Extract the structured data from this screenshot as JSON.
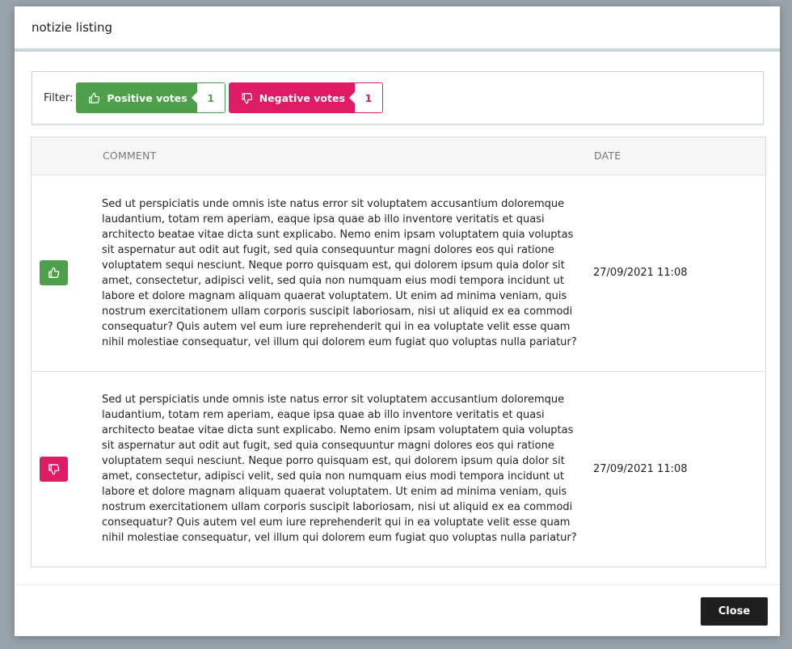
{
  "modal": {
    "title": "notizie listing"
  },
  "filter": {
    "label": "Filter:",
    "positive": {
      "label": "Positive votes",
      "count": "1",
      "icon": "thumbs-up-icon",
      "color": "#4e9f4a"
    },
    "negative": {
      "label": "Negative votes",
      "count": "1",
      "icon": "thumbs-down-icon",
      "color": "#dd1c65"
    }
  },
  "table": {
    "columns": [
      "",
      "COMMENT",
      "DATE"
    ],
    "rows": [
      {
        "vote": "positive",
        "icon": "thumbs-up-icon",
        "comment": "Sed ut perspiciatis unde omnis iste natus error sit voluptatem accusantium doloremque laudantium, totam rem aperiam, eaque ipsa quae ab illo inventore veritatis et quasi architecto beatae vitae dicta sunt explicabo. Nemo enim ipsam voluptatem quia voluptas sit aspernatur aut odit aut fugit, sed quia consequuntur magni dolores eos qui ratione voluptatem sequi nesciunt. Neque porro quisquam est, qui dolorem ipsum quia dolor sit amet, consectetur, adipisci velit, sed quia non numquam eius modi tempora incidunt ut labore et dolore magnam aliquam quaerat voluptatem. Ut enim ad minima veniam, quis nostrum exercitationem ullam corporis suscipit laboriosam, nisi ut aliquid ex ea commodi consequatur? Quis autem vel eum iure reprehenderit qui in ea voluptate velit esse quam nihil molestiae consequatur, vel illum qui dolorem eum fugiat quo voluptas nulla pariatur?",
        "date": "27/09/2021 11:08"
      },
      {
        "vote": "negative",
        "icon": "thumbs-down-icon",
        "comment": "Sed ut perspiciatis unde omnis iste natus error sit voluptatem accusantium doloremque laudantium, totam rem aperiam, eaque ipsa quae ab illo inventore veritatis et quasi architecto beatae vitae dicta sunt explicabo. Nemo enim ipsam voluptatem quia voluptas sit aspernatur aut odit aut fugit, sed quia consequuntur magni dolores eos qui ratione voluptatem sequi nesciunt. Neque porro quisquam est, qui dolorem ipsum quia dolor sit amet, consectetur, adipisci velit, sed quia non numquam eius modi tempora incidunt ut labore et dolore magnam aliquam quaerat voluptatem. Ut enim ad minima veniam, quis nostrum exercitationem ullam corporis suscipit laboriosam, nisi ut aliquid ex ea commodi consequatur? Quis autem vel eum iure reprehenderit qui in ea voluptate velit esse quam nihil molestiae consequatur, vel illum qui dolorem eum fugiat quo voluptas nulla pariatur?",
        "date": "27/09/2021 11:08"
      }
    ]
  },
  "footer": {
    "close_label": "Close"
  }
}
